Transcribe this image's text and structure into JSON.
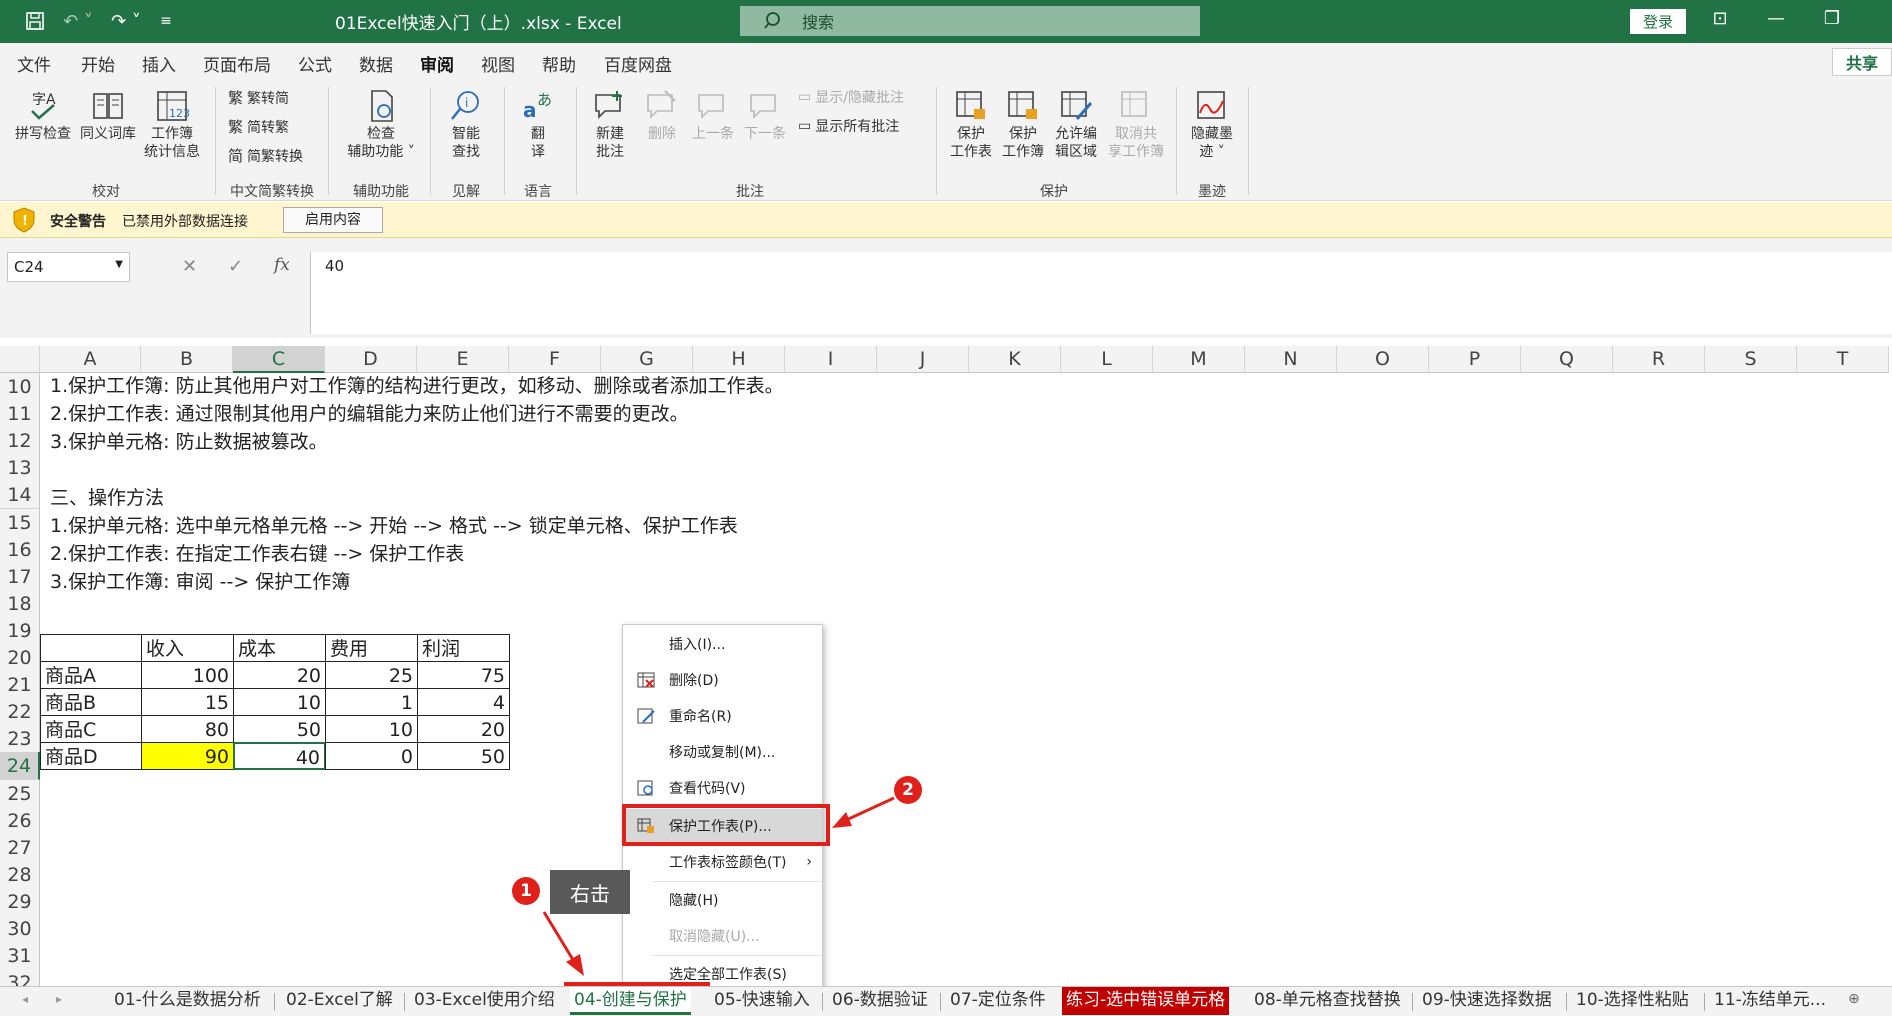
{
  "window": {
    "title": "01Excel快速入门（上）.xlsx  -  Excel",
    "search_placeholder": "搜索",
    "login": "登录",
    "share": "共享"
  },
  "menu": [
    "文件",
    "开始",
    "插入",
    "页面布局",
    "公式",
    "数据",
    "审阅",
    "视图",
    "帮助",
    "百度网盘"
  ],
  "ribbon": {
    "spell": "拼写检查",
    "thesaurus": "同义词库",
    "wbstats1": "工作簿",
    "wbstats2": "统计信息",
    "trad": "繁转简",
    "simp": "简转繁",
    "convert": "简繁转换",
    "check1": "检查",
    "check2": "辅助功能",
    "smart1": "智能",
    "smart2": "查找",
    "trans1": "翻",
    "trans2": "译",
    "newc1": "新建",
    "newc2": "批注",
    "del": "删除",
    "prev": "上一条",
    "next": "下一条",
    "showhide": "显示/隐藏批注",
    "showall": "显示所有批注",
    "psheet1": "保护",
    "psheet2": "工作表",
    "pwb1": "保护",
    "pwb2": "工作簿",
    "allow1": "允许编",
    "allow2": "辑区域",
    "unshare1": "取消共",
    "unshare2": "享工作簿",
    "ink1": "隐藏墨",
    "ink2": "迹",
    "groups": {
      "proof": "校对",
      "cn": "中文简繁转换",
      "access": "辅助功能",
      "insight": "见解",
      "lang": "语言",
      "comments": "批注",
      "protect": "保护",
      "ink": "墨迹"
    }
  },
  "security": {
    "title": "安全警告",
    "message": "已禁用外部数据连接",
    "button": "启用内容"
  },
  "formula": {
    "namebox": "C24",
    "value": "40",
    "fx": "fx"
  },
  "columns": [
    "A",
    "B",
    "C",
    "D",
    "E",
    "F",
    "G",
    "H",
    "I",
    "J",
    "K",
    "L",
    "M",
    "N",
    "O",
    "P",
    "Q",
    "R",
    "S",
    "T"
  ],
  "rows": [
    "10",
    "11",
    "12",
    "13",
    "14",
    "15",
    "16",
    "17",
    "18",
    "19",
    "20",
    "21",
    "22",
    "23",
    "24",
    "25",
    "26",
    "27",
    "28",
    "29",
    "30",
    "31",
    "32"
  ],
  "text": {
    "r10": "1.保护工作簿:   防止其他用户对工作簿的结构进行更改，如移动、删除或者添加工作表。",
    "r11": "2.保护工作表:   通过限制其他用户的编辑能力来防止他们进行不需要的更改。",
    "r12": "3.保护单元格:   防止数据被篡改。",
    "r14": "三、操作方法",
    "r15": "1.保护单元格:  选中单元格单元格 --> 开始 --> 格式 --> 锁定单元格、保护工作表",
    "r16": "2.保护工作表:  在指定工作表右键 --> 保护工作表",
    "r17": "3.保护工作簿:  审阅 --> 保护工作簿"
  },
  "table": {
    "headers": [
      "收入",
      "成本",
      "费用",
      "利润"
    ],
    "rows": [
      {
        "name": "商品A",
        "v": [
          "100",
          "20",
          "25",
          "75"
        ]
      },
      {
        "name": "商品B",
        "v": [
          "15",
          "10",
          "1",
          "4"
        ]
      },
      {
        "name": "商品C",
        "v": [
          "80",
          "50",
          "10",
          "20"
        ]
      },
      {
        "name": "商品D",
        "v": [
          "90",
          "40",
          "0",
          "50"
        ]
      }
    ]
  },
  "context_menu": [
    "插入(I)...",
    "删除(D)",
    "重命名(R)",
    "移动或复制(M)...",
    "查看代码(V)",
    "保护工作表(P)...",
    "工作表标签颜色(T)",
    "隐藏(H)",
    "取消隐藏(U)...",
    "选定全部工作表(S)"
  ],
  "annotation": {
    "tooltip": "右击",
    "badge1": "1",
    "badge2": "2"
  },
  "tabs": [
    "01-什么是数据分析",
    "02-Excel了解",
    "03-Excel使用介绍",
    "04-创建与保护",
    "05-快速输入",
    "06-数据验证",
    "07-定位条件",
    "练习-选中错误单元格",
    "08-单元格查找替换",
    "09-快速选择数据",
    "10-选择性粘贴",
    "11-冻结单元..."
  ],
  "colors": {
    "accent": "#217346",
    "highlight": "#ffff00",
    "annotation_red": "#e0201b"
  }
}
